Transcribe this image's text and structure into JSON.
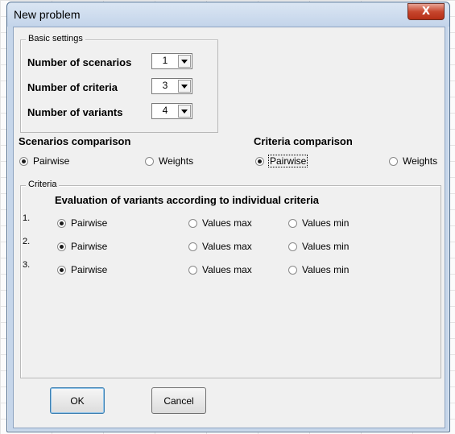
{
  "window": {
    "title": "New problem",
    "close_glyph": "X"
  },
  "basic_settings": {
    "legend": "Basic settings",
    "rows": [
      {
        "label": "Number of scenarios",
        "value": "1"
      },
      {
        "label": "Number of criteria",
        "value": "3"
      },
      {
        "label": "Number of variants",
        "value": "4"
      }
    ]
  },
  "scenarios_comparison": {
    "title": "Scenarios comparison",
    "options": [
      "Pairwise",
      "Weights"
    ],
    "selected": "Pairwise"
  },
  "criteria_comparison": {
    "title": "Criteria comparison",
    "options": [
      "Pairwise",
      "Weights"
    ],
    "selected": "Pairwise"
  },
  "criteria": {
    "legend": "Criteria",
    "heading": "Evaluation of variants according to individual criteria",
    "rows": [
      {
        "index": "1.",
        "options": [
          "Pairwise",
          "Values max",
          "Values min"
        ],
        "selected": "Pairwise"
      },
      {
        "index": "2.",
        "options": [
          "Pairwise",
          "Values max",
          "Values min"
        ],
        "selected": "Pairwise"
      },
      {
        "index": "3.",
        "options": [
          "Pairwise",
          "Values max",
          "Values min"
        ],
        "selected": "Pairwise"
      }
    ]
  },
  "buttons": {
    "ok": "OK",
    "cancel": "Cancel"
  }
}
